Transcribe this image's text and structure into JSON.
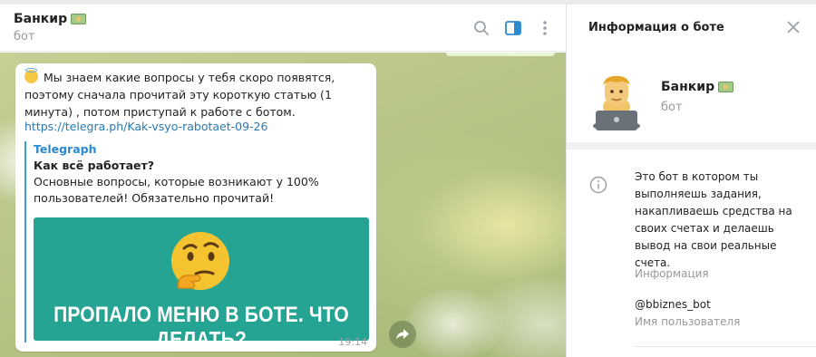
{
  "chat": {
    "title": "Банкир",
    "subtitle": "бот",
    "message": {
      "text": "Мы знаем какие вопросы у тебя скоро появятся, поэтому сначала прочитай эту короткую статью (1 минута) , потом приступай к работе с ботом.",
      "link": "https://telegra.ph/Kak-vsyo-rabotaet-09-26",
      "preview": {
        "site": "Telegraph",
        "title": "Как всё работает?",
        "description": "Основные вопросы, которые возникают у 100% пользователей! Обязательно прочитай!",
        "image_caption": "ПРОПАЛО МЕНЮ В БОТЕ. ЧТО ДЕЛАТЬ?"
      },
      "time": "19:14"
    }
  },
  "panel": {
    "title": "Информация о боте",
    "bot_name": "Банкир",
    "bot_subtitle": "бот",
    "description": "Это бот в котором ты выполняешь задания, накапливаешь средства на своих счетах и делаешь вывод на свои реальные счета.",
    "description_label": "Информация",
    "username": "@bbiznes_bot",
    "username_label": "Имя пользователя"
  },
  "icons": {
    "title_emoji": "money-bill-icon",
    "search": "search-icon",
    "sidebar_toggle": "sidebar-toggle-icon",
    "more": "more-vertical-icon",
    "close": "close-icon",
    "info": "info-icon",
    "share": "share-icon",
    "avatar": "bot-avatar-laptop"
  },
  "colors": {
    "accent": "#2a8bd0",
    "link": "#2a7ab0",
    "preview_image_bg": "#25a494",
    "muted_text": "#999999"
  }
}
